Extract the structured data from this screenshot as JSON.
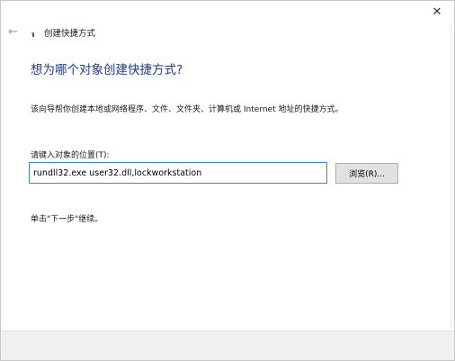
{
  "titlebar": {
    "close_glyph": "✕"
  },
  "nav": {
    "back_glyph": "←",
    "title": "创建快捷方式"
  },
  "main": {
    "heading": "想为哪个对象创建快捷方式?",
    "description": "该向导帮你创建本地或网络程序、文件、文件夹、计算机或 Internet 地址的快捷方式。",
    "field_label": "请键入对象的位置(T):",
    "location_value": "rundll32.exe user32.dll,lockworkstation",
    "browse_label": "浏览(R)...",
    "hint": "单击\"下一步\"继续。"
  },
  "colors": {
    "heading": "#1f3c8c",
    "input_focus_border": "#3c86d4",
    "footer_bg": "#f0f0f0"
  }
}
